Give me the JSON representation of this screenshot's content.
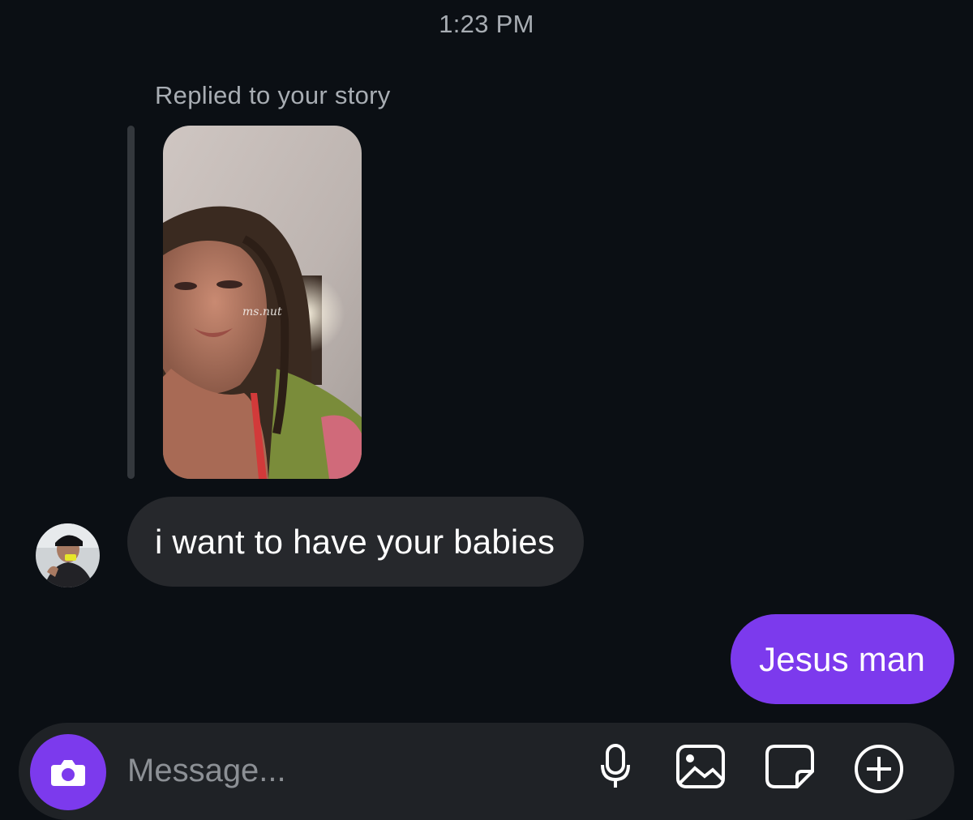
{
  "conversation": {
    "timestamp": "1:23 PM",
    "story_reply": {
      "label": "Replied to your story",
      "story_caption": "ms.nut"
    },
    "messages": [
      {
        "sender": "them",
        "text": "i want to have your babies"
      },
      {
        "sender": "me",
        "text": "Jesus man"
      }
    ]
  },
  "composer": {
    "placeholder": "Message...",
    "icons": [
      "camera-icon",
      "microphone-icon",
      "gallery-icon",
      "sticker-icon",
      "add-icon"
    ]
  },
  "colors": {
    "background": "#0b0f14",
    "received_bubble": "#26282c",
    "sent_bubble": "#7c3aed",
    "muted_text": "#a8adb3",
    "composer_bg": "#1f2226"
  }
}
